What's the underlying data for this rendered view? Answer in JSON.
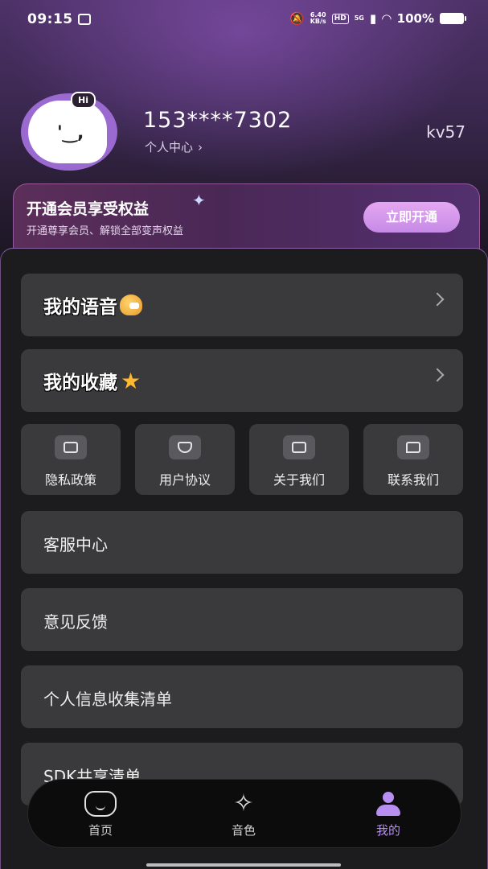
{
  "status_bar": {
    "time": "09:15",
    "net_speed_top": "6.40",
    "net_speed_bottom": "KB/s",
    "hd": "HD",
    "network": "5G",
    "battery": "100%"
  },
  "profile": {
    "avatar_bubble": "Hi",
    "phone": "153****7302",
    "personal_center": "个人中心",
    "version": "kv57"
  },
  "vip": {
    "title": "开通会员享受权益",
    "subtitle": "开通尊享会员、解锁全部变声权益",
    "button": "立即开通"
  },
  "menu": {
    "my_voice": "我的语音",
    "my_favorites": "我的收藏",
    "quick_links": [
      {
        "label": "隐私政策",
        "icon": "lock-icon"
      },
      {
        "label": "用户协议",
        "icon": "shield-icon"
      },
      {
        "label": "关于我们",
        "icon": "share-icon"
      },
      {
        "label": "联系我们",
        "icon": "message-icon"
      }
    ],
    "list": [
      "客服中心",
      "意见反馈",
      "个人信息收集清单",
      "SDK共享清单"
    ]
  },
  "bottom_nav": {
    "items": [
      {
        "label": "首页",
        "icon": "home-icon"
      },
      {
        "label": "音色",
        "icon": "sparkle-icon"
      },
      {
        "label": "我的",
        "icon": "user-icon",
        "active": true
      }
    ]
  },
  "colors": {
    "accent": "#b88ff0",
    "card": "#3a3a3c",
    "background": "#1c1c1e"
  }
}
